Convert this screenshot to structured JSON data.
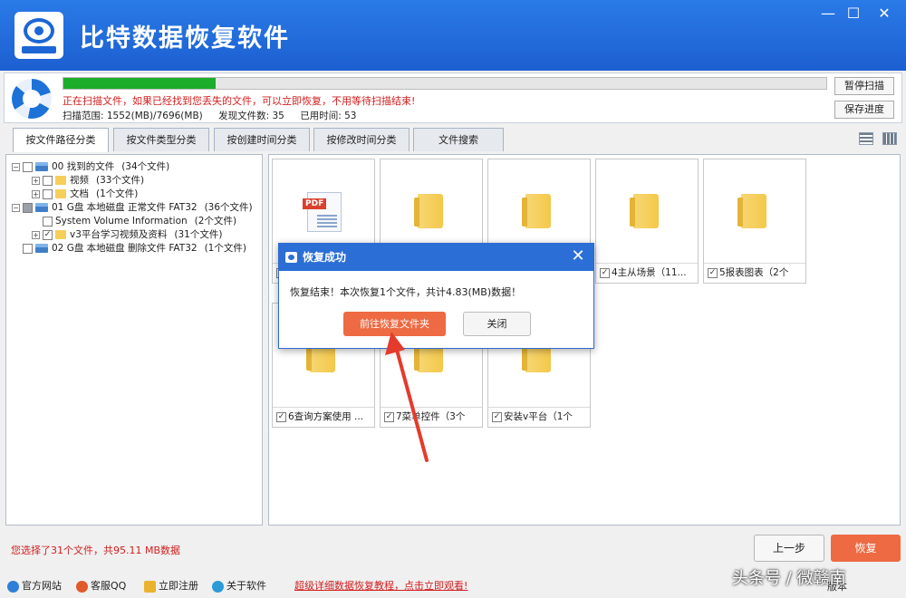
{
  "app": {
    "title": "比特数据恢复软件",
    "window_buttons": [
      "—",
      "☐",
      "✕"
    ]
  },
  "scan": {
    "progress_percent": 20,
    "status_text": "正在扫描文件，如果已经找到您丢失的文件，可以立即恢复，不用等待扫描结束!",
    "range_label": "扫描范围: 1552(MB)/7696(MB)",
    "found_label": "发现文件数: 35",
    "time_label": "已用时间: 53",
    "pause_button": "暂停扫描",
    "save_button": "保存进度"
  },
  "tabs": [
    {
      "label": "按文件路径分类",
      "active": true
    },
    {
      "label": "按文件类型分类",
      "active": false
    },
    {
      "label": "按创建时间分类",
      "active": false
    },
    {
      "label": "按修改时间分类",
      "active": false
    },
    {
      "label": "文件搜索",
      "active": false
    }
  ],
  "tree": [
    {
      "label": "00 找到的文件",
      "count": "(34个文件)",
      "level": 0,
      "checked": "none",
      "icon": "drive"
    },
    {
      "label": "视频",
      "count": "(33个文件)",
      "level": 1,
      "checked": "none",
      "icon": "folder"
    },
    {
      "label": "文档",
      "count": "(1个文件)",
      "level": 1,
      "checked": "none",
      "icon": "folder"
    },
    {
      "label": "01 G盘 本地磁盘 正常文件 FAT32",
      "count": "(36个文件)",
      "level": 0,
      "checked": "partial",
      "icon": "drive"
    },
    {
      "label": "System Volume Information",
      "count": "(2个文件)",
      "level": 1,
      "checked": "none",
      "icon": "none"
    },
    {
      "label": "v3平台学习视频及资料",
      "count": "(31个文件)",
      "level": 1,
      "checked": "checked",
      "icon": "folder"
    },
    {
      "label": "02 G盘 本地磁盘 删除文件 FAT32",
      "count": "(1个文件)",
      "level": 0,
      "checked": "none",
      "icon": "drive"
    }
  ],
  "files": [
    {
      "caption": "",
      "type": "pdf"
    },
    {
      "caption": "",
      "type": "folder"
    },
    {
      "caption": "",
      "type": "folder"
    },
    {
      "caption": "4主从场景（11...",
      "type": "folder"
    },
    {
      "caption": "5报表图表（2个",
      "type": "folder"
    },
    {
      "caption": "6查询方案使用 ...",
      "type": "folder"
    },
    {
      "caption": "7菜单控件（3个",
      "type": "folder"
    },
    {
      "caption": "安装v平台（1个",
      "type": "folder"
    }
  ],
  "dialog": {
    "title": "恢复成功",
    "message": "恢复结束！本次恢复1个文件，共计4.83(MB)数据！",
    "primary_button": "前往恢复文件夹",
    "close_button": "关闭",
    "close_icon": "✕"
  },
  "selection_info": "您选择了31个文件，共95.11 MB数据",
  "buttons": {
    "prev": "上一步",
    "recover": "恢复"
  },
  "footer": {
    "links": [
      "官方网站",
      "客服QQ",
      "立即注册",
      "关于软件"
    ],
    "promo": "超级详细数据恢复教程，点击立即观看!",
    "version": "版本"
  },
  "watermark": "头条号 / 微赣南",
  "colors": {
    "titlebar": "#1c5fd0",
    "progress": "#1cad2a",
    "accent": "#ee6a43",
    "warning_text": "#d21e1e",
    "annotation_arrow": "#e53b2c"
  }
}
